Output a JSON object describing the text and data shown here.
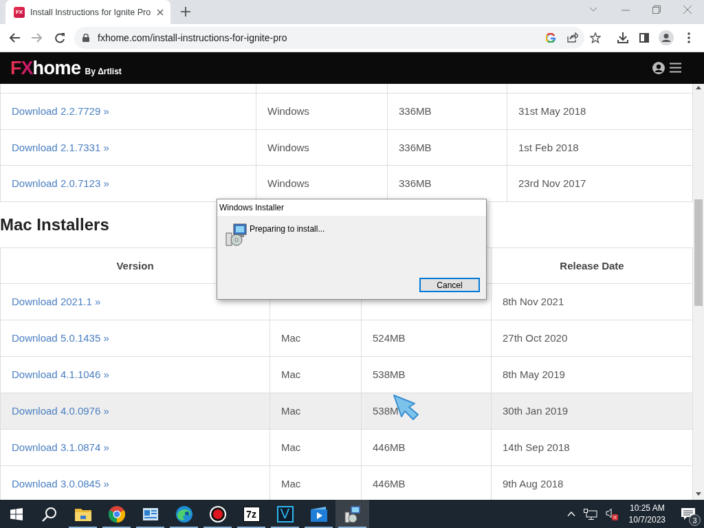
{
  "browser": {
    "tab": {
      "favicon": "FX",
      "title": "Install Instructions for Ignite Pro",
      "selected": true
    },
    "url": "fxhome.com/install-instructions-for-ignite-pro"
  },
  "site_header": {
    "logo": {
      "mark": "FX",
      "word": "home",
      "byline": "By Δrtlist"
    }
  },
  "windows_table": {
    "rows": [
      {
        "version": "Download 2.2.7729 »",
        "os": "Windows",
        "size": "336MB",
        "date": "31st May 2018"
      },
      {
        "version": "Download 2.1.7331 »",
        "os": "Windows",
        "size": "336MB",
        "date": "1st Feb 2018"
      },
      {
        "version": "Download 2.0.7123 »",
        "os": "Windows",
        "size": "336MB",
        "date": "23rd Nov 2017"
      }
    ]
  },
  "mac_section": {
    "heading": "Mac Installers",
    "columns": [
      "Version",
      "Release Date"
    ],
    "rows": [
      {
        "version": "Download 2021.1 »",
        "date": "8th Nov 2021",
        "hovered": false
      },
      {
        "version": "Download 5.0.1435 »",
        "os": "Mac",
        "size": "524MB",
        "date": "27th Oct 2020",
        "hovered": false
      },
      {
        "version": "Download 4.1.1046 »",
        "os": "Mac",
        "size": "538MB",
        "date": "8th May 2019",
        "hovered": false
      },
      {
        "version": "Download 4.0.0976 »",
        "os": "Mac",
        "size": "538M",
        "date": "30th Jan 2019",
        "hovered": true
      },
      {
        "version": "Download 3.1.0874 »",
        "os": "Mac",
        "size": "446MB",
        "date": "14th Sep 2018",
        "hovered": false
      },
      {
        "version": "Download 3.0.0845 »",
        "os": "Mac",
        "size": "446MB",
        "date": "9th Aug 2018",
        "hovered": false
      }
    ]
  },
  "dialog": {
    "title": "Windows Installer",
    "message": "Preparing to install...",
    "button": {
      "label": "Cancel",
      "focused": true
    }
  },
  "taskbar": {
    "apps": [
      {
        "kind": "folder",
        "running": true,
        "active": false
      },
      {
        "kind": "chrome",
        "running": true,
        "active": false
      },
      {
        "kind": "card",
        "running": true,
        "active": false
      },
      {
        "kind": "edge",
        "running": true,
        "active": false
      },
      {
        "kind": "record",
        "running": true,
        "active": false
      },
      {
        "kind": "archive",
        "glyph": "7z",
        "running": true,
        "active": false
      },
      {
        "kind": "editor",
        "glyph": "V",
        "running": true,
        "active": false
      },
      {
        "kind": "video",
        "running": true,
        "active": false
      },
      {
        "kind": "installer",
        "running": true,
        "active": true
      }
    ],
    "clock": {
      "time": "10:25 AM",
      "date": "10/7/2023"
    },
    "notifications": "3"
  }
}
